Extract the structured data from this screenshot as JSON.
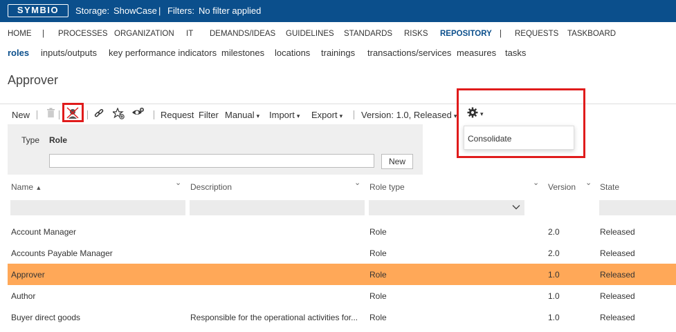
{
  "header": {
    "logo": "SYMBIO",
    "storage_label": "Storage:",
    "storage_value": "ShowCase",
    "separator": "|",
    "filters_label": "Filters:",
    "filters_value": "No filter applied"
  },
  "main_nav": [
    "HOME",
    "|",
    "PROCESSES",
    "ORGANIZATION",
    "IT",
    "DEMANDS/IDEAS",
    "GUIDELINES",
    "STANDARDS",
    "RISKS",
    "REPOSITORY",
    "|",
    "REQUESTS",
    "TASKBOARD"
  ],
  "sub_nav": [
    "roles",
    "inputs/outputs",
    "key performance indicators",
    "milestones",
    "locations",
    "trainings",
    "transactions/services",
    "measures",
    "tasks"
  ],
  "page_title": "Approver",
  "toolbar": {
    "new": "New",
    "request": "Request",
    "filter": "Filter",
    "manual": "Manual",
    "import": "Import",
    "export": "Export",
    "version": "Version: 1.0, Released",
    "caret": "▾"
  },
  "settings_menu": {
    "items": [
      "Consolidate"
    ]
  },
  "filter_panel": {
    "type_label": "Type",
    "type_value": "Role",
    "search_value": "",
    "new_button": "New"
  },
  "table": {
    "columns": [
      "Name",
      "Description",
      "Role type",
      "Version",
      "State"
    ],
    "sort_indicator": "▲",
    "rows": [
      {
        "name": "Account Manager",
        "description": "",
        "role_type": "Role",
        "version": "2.0",
        "state": "Released"
      },
      {
        "name": "Accounts Payable Manager",
        "description": "",
        "role_type": "Role",
        "version": "2.0",
        "state": "Released"
      },
      {
        "name": "Approver",
        "description": "",
        "role_type": "Role",
        "version": "1.0",
        "state": "Released"
      },
      {
        "name": "Author",
        "description": "",
        "role_type": "Role",
        "version": "1.0",
        "state": "Released"
      },
      {
        "name": "Buyer direct goods",
        "description": "Responsible for the operational activities for...",
        "role_type": "Role",
        "version": "1.0",
        "state": "Released"
      }
    ],
    "selected_row_color": "#ffa858"
  },
  "colors": {
    "header_bg": "#0b4f8c",
    "accent": "#0b4f8c",
    "highlight_box": "#e01b1b"
  }
}
